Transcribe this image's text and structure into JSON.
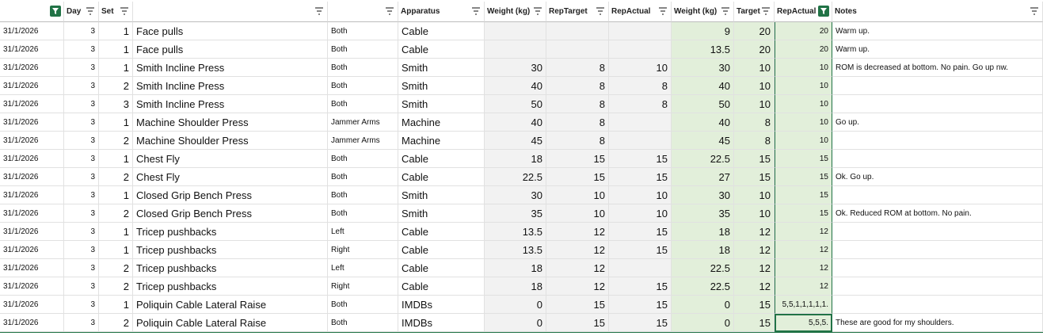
{
  "headers": [
    {
      "label": "",
      "filter": "active"
    },
    {
      "label": "Day",
      "filter": "normal"
    },
    {
      "label": "Set",
      "filter": "normal"
    },
    {
      "label": "",
      "filter": "normal"
    },
    {
      "label": "",
      "filter": "normal"
    },
    {
      "label": "Apparatus",
      "filter": "normal"
    },
    {
      "label": "Weight (kg)",
      "filter": "normal"
    },
    {
      "label": "RepTarget",
      "filter": "normal"
    },
    {
      "label": "RepActual",
      "filter": "normal"
    },
    {
      "label": "Weight (kg)",
      "filter": "normal"
    },
    {
      "label": "Target",
      "filter": "normal"
    },
    {
      "label": "RepActual",
      "filter": "active"
    },
    {
      "label": "Notes",
      "filter": "normal"
    }
  ],
  "rows": [
    [
      "31/1/2026",
      "3",
      "1",
      "Face pulls",
      "Both",
      "Cable",
      "",
      "",
      "",
      "9",
      "20",
      "20",
      "Warm up."
    ],
    [
      "31/1/2026",
      "3",
      "1",
      "Face pulls",
      "Both",
      "Cable",
      "",
      "",
      "",
      "13.5",
      "20",
      "20",
      "Warm up."
    ],
    [
      "31/1/2026",
      "3",
      "1",
      "Smith Incline Press",
      "Both",
      "Smith",
      "30",
      "8",
      "10",
      "30",
      "10",
      "10",
      "ROM is decreased at bottom. No pain. Go up nw."
    ],
    [
      "31/1/2026",
      "3",
      "2",
      "Smith Incline Press",
      "Both",
      "Smith",
      "40",
      "8",
      "8",
      "40",
      "10",
      "10",
      ""
    ],
    [
      "31/1/2026",
      "3",
      "3",
      "Smith Incline Press",
      "Both",
      "Smith",
      "50",
      "8",
      "8",
      "50",
      "10",
      "10",
      ""
    ],
    [
      "31/1/2026",
      "3",
      "1",
      "Machine Shoulder Press",
      "Jammer Arms",
      "Machine",
      "40",
      "8",
      "",
      "40",
      "8",
      "10",
      "Go up."
    ],
    [
      "31/1/2026",
      "3",
      "2",
      "Machine Shoulder Press",
      "Jammer Arms",
      "Machine",
      "45",
      "8",
      "",
      "45",
      "8",
      "10",
      ""
    ],
    [
      "31/1/2026",
      "3",
      "1",
      "Chest Fly",
      "Both",
      "Cable",
      "18",
      "15",
      "15",
      "22.5",
      "15",
      "15",
      ""
    ],
    [
      "31/1/2026",
      "3",
      "2",
      "Chest Fly",
      "Both",
      "Cable",
      "22.5",
      "15",
      "15",
      "27",
      "15",
      "15",
      "Ok. Go up."
    ],
    [
      "31/1/2026",
      "3",
      "1",
      "Closed Grip Bench Press",
      "Both",
      "Smith",
      "30",
      "10",
      "10",
      "30",
      "10",
      "15",
      ""
    ],
    [
      "31/1/2026",
      "3",
      "2",
      "Closed Grip Bench Press",
      "Both",
      "Smith",
      "35",
      "10",
      "10",
      "35",
      "10",
      "15",
      "Ok. Reduced ROM at bottom. No pain."
    ],
    [
      "31/1/2026",
      "3",
      "1",
      "Tricep pushbacks",
      "Left",
      "Cable",
      "13.5",
      "12",
      "15",
      "18",
      "12",
      "12",
      ""
    ],
    [
      "31/1/2026",
      "3",
      "1",
      "Tricep pushbacks",
      "Right",
      "Cable",
      "13.5",
      "12",
      "15",
      "18",
      "12",
      "12",
      ""
    ],
    [
      "31/1/2026",
      "3",
      "2",
      "Tricep pushbacks",
      "Left",
      "Cable",
      "18",
      "12",
      "",
      "22.5",
      "12",
      "12",
      ""
    ],
    [
      "31/1/2026",
      "3",
      "2",
      "Tricep pushbacks",
      "Right",
      "Cable",
      "18",
      "12",
      "15",
      "22.5",
      "12",
      "12",
      ""
    ],
    [
      "31/1/2026",
      "3",
      "1",
      "Poliquin Cable Lateral Raise",
      "Both",
      "IMDBs",
      "0",
      "15",
      "15",
      "0",
      "15",
      "5,5,1,1,1,1,1.",
      ""
    ],
    [
      "31/1/2026",
      "3",
      "2",
      "Poliquin Cable Lateral Raise",
      "Both",
      "IMDBs",
      "0",
      "15",
      "15",
      "0",
      "15",
      "5,5,5.",
      "These are good for my shoulders."
    ]
  ],
  "colors": {
    "accent": "#217346",
    "green_fill": "#e2efda",
    "grey_fill": "#f2f2f2"
  }
}
